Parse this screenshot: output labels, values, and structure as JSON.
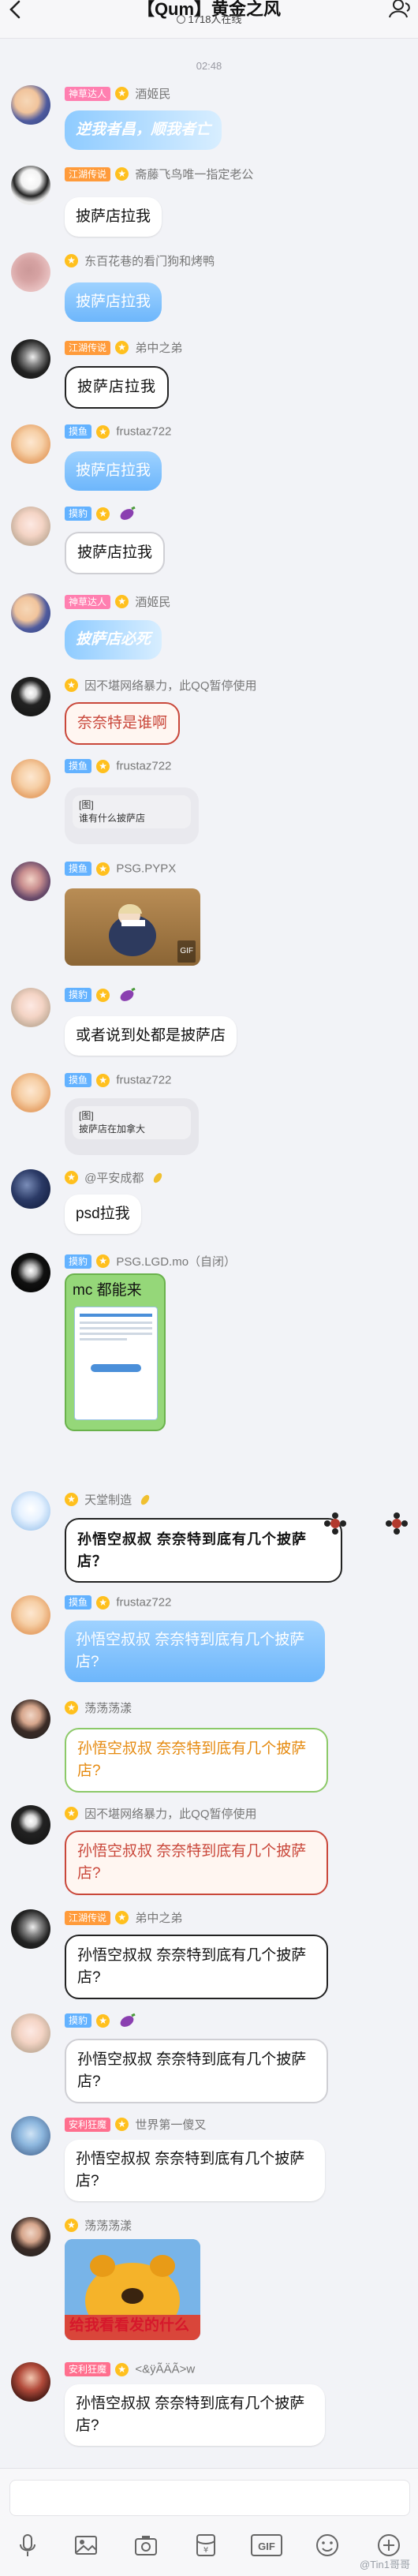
{
  "header": {
    "title": "【Qum】黄金之风",
    "online": "1718人在线"
  },
  "timestamp": "02:48",
  "messages": [
    {
      "tag": "神草达人",
      "tag_color": "#ff7fb0",
      "name": "酒姬民",
      "text": "逆我者昌，顺我者亡"
    },
    {
      "tag": "江湖传说",
      "tag_color": "#ff9b3b",
      "name": "斋藤飞鸟唯一指定老公",
      "text": "披萨店拉我"
    },
    {
      "tag": "",
      "tag_color": "",
      "name": "东百花巷的看门狗和烤鸭",
      "text": "披萨店拉我"
    },
    {
      "tag": "江湖传说",
      "tag_color": "#ff9b3b",
      "name": "弟中之弟",
      "text": "披萨店拉我"
    },
    {
      "tag": "摸鱼",
      "tag_color": "#63b2ff",
      "name": "frustaz722",
      "text": "披萨店拉我"
    },
    {
      "tag": "摸豹",
      "tag_color": "#63b2ff",
      "name": "",
      "text": "披萨店拉我"
    },
    {
      "tag": "神草达人",
      "tag_color": "#ff7fb0",
      "name": "酒姬民",
      "text": "披萨店必死"
    },
    {
      "tag": "",
      "tag_color": "",
      "name": "因不堪网络暴力，此QQ暂停使用",
      "text": "奈奈特是谁啊"
    },
    {
      "tag": "摸鱼",
      "tag_color": "#63b2ff",
      "name": "frustaz722",
      "text": "谁有什么披萨店",
      "reply_quote": "[图]"
    },
    {
      "tag": "摸鱼",
      "tag_color": "#63b2ff",
      "name": "PSG.PYPX",
      "text": "",
      "image_label": "GIF"
    },
    {
      "tag": "摸豹",
      "tag_color": "#63b2ff",
      "name": "",
      "text": "或者说到处都是披萨店"
    },
    {
      "tag": "摸鱼",
      "tag_color": "#63b2ff",
      "name": "frustaz722",
      "text": "披萨店在加拿大",
      "reply_quote": "[图]"
    },
    {
      "tag": "",
      "tag_color": "",
      "name": "@平安成都",
      "text": "psd拉我"
    },
    {
      "tag": "摸豹",
      "tag_color": "#63b2ff",
      "name": "PSG.LGD.mo（自闭）",
      "text": "mc 都能来"
    },
    {
      "tag": "",
      "tag_color": "",
      "name": "天堂制造",
      "text": "孙悟空叔叔 奈奈特到底有几个披萨店？"
    },
    {
      "tag": "摸鱼",
      "tag_color": "#63b2ff",
      "name": "frustaz722",
      "text": "孙悟空叔叔 奈奈特到底有几个披萨店?"
    },
    {
      "tag": "",
      "tag_color": "",
      "name": "荡荡荡漾",
      "text": "孙悟空叔叔 奈奈特到底有几个披萨店?"
    },
    {
      "tag": "",
      "tag_color": "",
      "name": "因不堪网络暴力，此QQ暂停使用",
      "text": "孙悟空叔叔 奈奈特到底有几个披萨店?"
    },
    {
      "tag": "江湖传说",
      "tag_color": "#ff9b3b",
      "name": "弟中之弟",
      "text": "孙悟空叔叔 奈奈特到底有几个披萨店?"
    },
    {
      "tag": "摸豹",
      "tag_color": "#63b2ff",
      "name": "",
      "text": "孙悟空叔叔 奈奈特到底有几个披萨店?"
    },
    {
      "tag": "安利狂魔",
      "tag_color": "#ff6f8e",
      "name": "世界第一傻叉",
      "text": "孙悟空叔叔 奈奈特到底有几个披萨店?"
    },
    {
      "tag": "",
      "tag_color": "",
      "name": "荡荡荡漾",
      "text": "",
      "image_caption": "给我看看发的什么"
    },
    {
      "tag": "安利狂魔",
      "tag_color": "#ff6f8e",
      "name": "<&ÿÃÄÃ>w",
      "text": "孙悟空叔叔 奈奈特到底有几个披萨店?"
    }
  ],
  "mc_card": {
    "line1": "mc 都能来"
  },
  "toolbar": {
    "gif_label": "GIF",
    "watermark": "@Tin1哥哥"
  },
  "colors": {
    "background": "#f2f3f7",
    "blue_bubble": "#7ec3ff",
    "star": "#ffc01e"
  }
}
